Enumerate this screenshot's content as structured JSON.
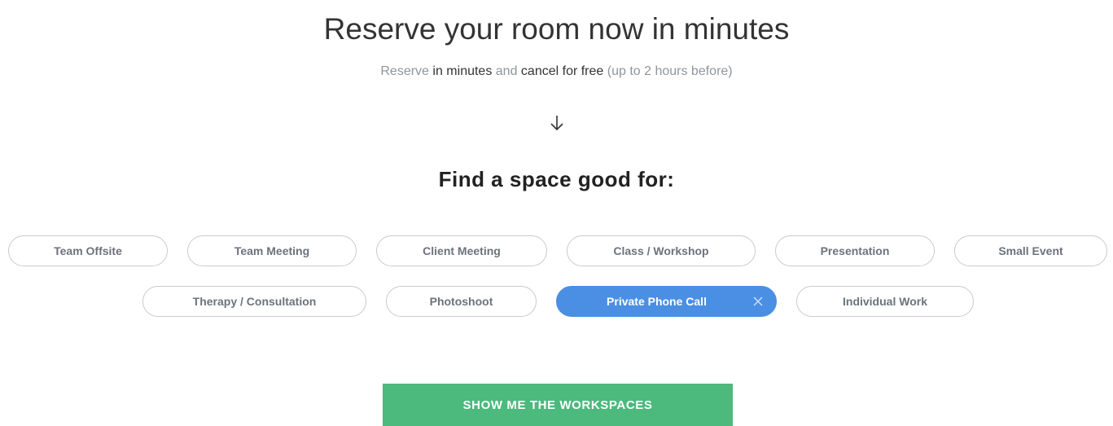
{
  "header": {
    "title": "Reserve your room now in minutes",
    "subtitle": {
      "part1": "Reserve ",
      "part2": "in minutes",
      "part3": " and ",
      "part4": "cancel for free",
      "part5": " (up to 2 hours before)"
    },
    "arrow_icon": "arrow-down-icon"
  },
  "filter": {
    "heading": "Find a space good for:",
    "options": [
      {
        "label": "Team Offsite",
        "selected": false
      },
      {
        "label": "Team Meeting",
        "selected": false
      },
      {
        "label": "Client Meeting",
        "selected": false
      },
      {
        "label": "Class / Workshop",
        "selected": false
      },
      {
        "label": "Presentation",
        "selected": false
      },
      {
        "label": "Small Event",
        "selected": false
      },
      {
        "label": "Therapy / Consultation",
        "selected": false
      },
      {
        "label": "Photoshoot",
        "selected": false
      },
      {
        "label": "Private Phone Call",
        "selected": true
      },
      {
        "label": "Individual Work",
        "selected": false
      }
    ]
  },
  "cta": {
    "label": "SHOW ME THE WORKSPACES"
  },
  "colors": {
    "accent_blue": "#4a8fe3",
    "cta_green": "#4cb97d",
    "muted_text": "#8f959e"
  }
}
